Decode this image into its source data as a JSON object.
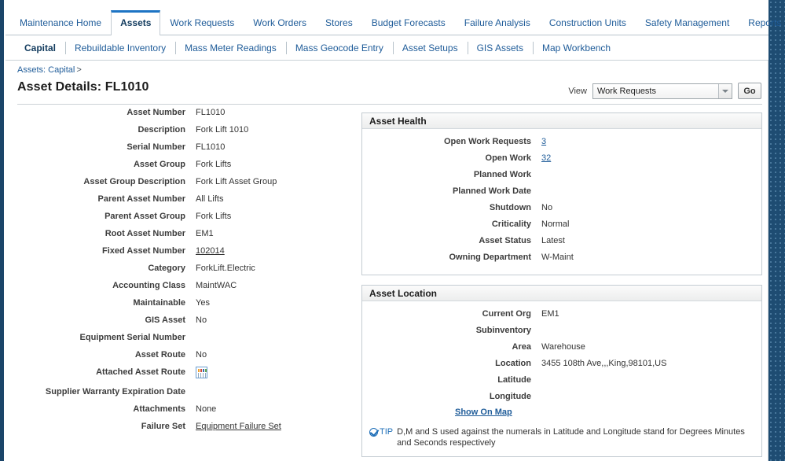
{
  "tabs": [
    {
      "label": "Maintenance Home",
      "active": false
    },
    {
      "label": "Assets",
      "active": true
    },
    {
      "label": "Work Requests",
      "active": false
    },
    {
      "label": "Work Orders",
      "active": false
    },
    {
      "label": "Stores",
      "active": false
    },
    {
      "label": "Budget Forecasts",
      "active": false
    },
    {
      "label": "Failure Analysis",
      "active": false
    },
    {
      "label": "Construction Units",
      "active": false
    },
    {
      "label": "Safety Management",
      "active": false
    },
    {
      "label": "Reports",
      "active": false
    }
  ],
  "subtabs": [
    {
      "label": "Capital",
      "active": true
    },
    {
      "label": "Rebuildable Inventory",
      "active": false
    },
    {
      "label": "Mass Meter Readings",
      "active": false
    },
    {
      "label": "Mass Geocode Entry",
      "active": false
    },
    {
      "label": "Asset Setups",
      "active": false
    },
    {
      "label": "GIS Assets",
      "active": false
    },
    {
      "label": "Map Workbench",
      "active": false
    }
  ],
  "breadcrumb": {
    "crumb": "Assets: Capital",
    "separator": ">"
  },
  "header": {
    "title": "Asset Details: FL1010",
    "view_label": "View",
    "view_value": "Work Requests",
    "go_label": "Go"
  },
  "details": [
    {
      "label": "Asset Number",
      "value": "FL1010",
      "link": false
    },
    {
      "label": "Description",
      "value": "Fork Lift 1010",
      "link": false
    },
    {
      "label": "Serial Number",
      "value": "FL1010",
      "link": false
    },
    {
      "label": "Asset Group",
      "value": "Fork Lifts",
      "link": false
    },
    {
      "label": "Asset Group Description",
      "value": "Fork Lift Asset Group",
      "link": false
    },
    {
      "label": "Parent Asset Number",
      "value": "All Lifts",
      "link": false
    },
    {
      "label": "Parent Asset Group",
      "value": "Fork Lifts",
      "link": false
    },
    {
      "label": "Root Asset Number",
      "value": "EM1",
      "link": false
    },
    {
      "label": "Fixed Asset Number",
      "value": "102014",
      "link": true
    },
    {
      "label": "Category",
      "value": "ForkLift.Electric",
      "link": false
    },
    {
      "label": "Accounting Class",
      "value": "MaintWAC",
      "link": false
    },
    {
      "label": "Maintainable",
      "value": "Yes",
      "link": false
    },
    {
      "label": "GIS Asset",
      "value": "No",
      "link": false
    },
    {
      "label": "Equipment Serial Number",
      "value": "",
      "link": false
    },
    {
      "label": "Asset Route",
      "value": "No",
      "link": false
    },
    {
      "label": "Attached Asset Route",
      "value": "",
      "link": false,
      "icon": "asset-route-report-icon"
    },
    {
      "label": "Supplier Warranty Expiration Date",
      "value": "",
      "link": false
    },
    {
      "label": "Attachments",
      "value": "None",
      "link": false
    },
    {
      "label": "Failure Set",
      "value": "Equipment Failure Set",
      "link": true
    }
  ],
  "asset_health": {
    "title": "Asset Health",
    "rows": [
      {
        "label": "Open Work Requests",
        "value": "3",
        "link": true
      },
      {
        "label": "Open Work",
        "value": "32",
        "link": true
      },
      {
        "label": "Planned Work",
        "value": "",
        "link": false
      },
      {
        "label": "Planned Work Date",
        "value": "",
        "link": false
      },
      {
        "label": "Shutdown",
        "value": "No",
        "link": false
      },
      {
        "label": "Criticality",
        "value": "Normal",
        "link": false
      },
      {
        "label": "Asset Status",
        "value": "Latest",
        "link": false
      },
      {
        "label": "Owning Department",
        "value": "W-Maint",
        "link": false
      }
    ]
  },
  "asset_location": {
    "title": "Asset Location",
    "rows": [
      {
        "label": "Current Org",
        "value": "EM1",
        "link": false
      },
      {
        "label": "Subinventory",
        "value": "",
        "link": false
      },
      {
        "label": "Area",
        "value": "Warehouse",
        "link": false
      },
      {
        "label": "Location",
        "value": "3455 108th Ave,,,King,98101,US",
        "link": false
      },
      {
        "label": "Latitude",
        "value": "",
        "link": false
      },
      {
        "label": "Longitude",
        "value": "",
        "link": false
      }
    ],
    "show_on_map": "Show On Map",
    "tip_word": "TIP",
    "tip_text": "D,M and S used against the numerals in Latitude and Longitude stand for Degrees Minutes and Seconds respectively"
  },
  "colors": {
    "rail": "#1b4569",
    "accent_blue": "#1f5c99",
    "active_tab_border": "#1d74c4",
    "panel_border": "#c4ccd2"
  }
}
